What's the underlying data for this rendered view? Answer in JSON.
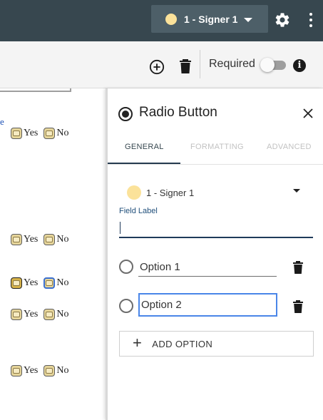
{
  "header": {
    "signer_label": "1 - Signer 1",
    "signer_color": "#fbe29a",
    "settings_icon": "gear-icon",
    "more_icon": "kebab-icon"
  },
  "toolbar": {
    "add_icon": "add-circle-icon",
    "delete_icon": "trash-icon",
    "required_label": "Required",
    "required_toggle_on": false,
    "info_icon": "info-icon",
    "info_glyph": "i"
  },
  "document": {
    "edge_text": "e",
    "rows": [
      {
        "yes": "Yes",
        "no": "No"
      },
      {
        "yes": "Yes",
        "no": "No"
      },
      {
        "yes": "Yes",
        "no": "No"
      },
      {
        "yes": "Yes",
        "no": "No"
      },
      {
        "yes": "Yes",
        "no": "No"
      }
    ]
  },
  "panel": {
    "title": "Radio Button",
    "tabs": [
      {
        "label": "GENERAL",
        "active": true
      },
      {
        "label": "FORMATTING",
        "active": false
      },
      {
        "label": "ADVANCED",
        "active": false
      }
    ],
    "signer_select": "1 - Signer 1",
    "field_label": "Field Label",
    "field_value": "",
    "options": [
      {
        "value": "Option 1"
      },
      {
        "value": "Option 2"
      }
    ],
    "add_option_label": "ADD OPTION",
    "accent_color": "#263a4f",
    "focus_color": "#4a86e8"
  }
}
